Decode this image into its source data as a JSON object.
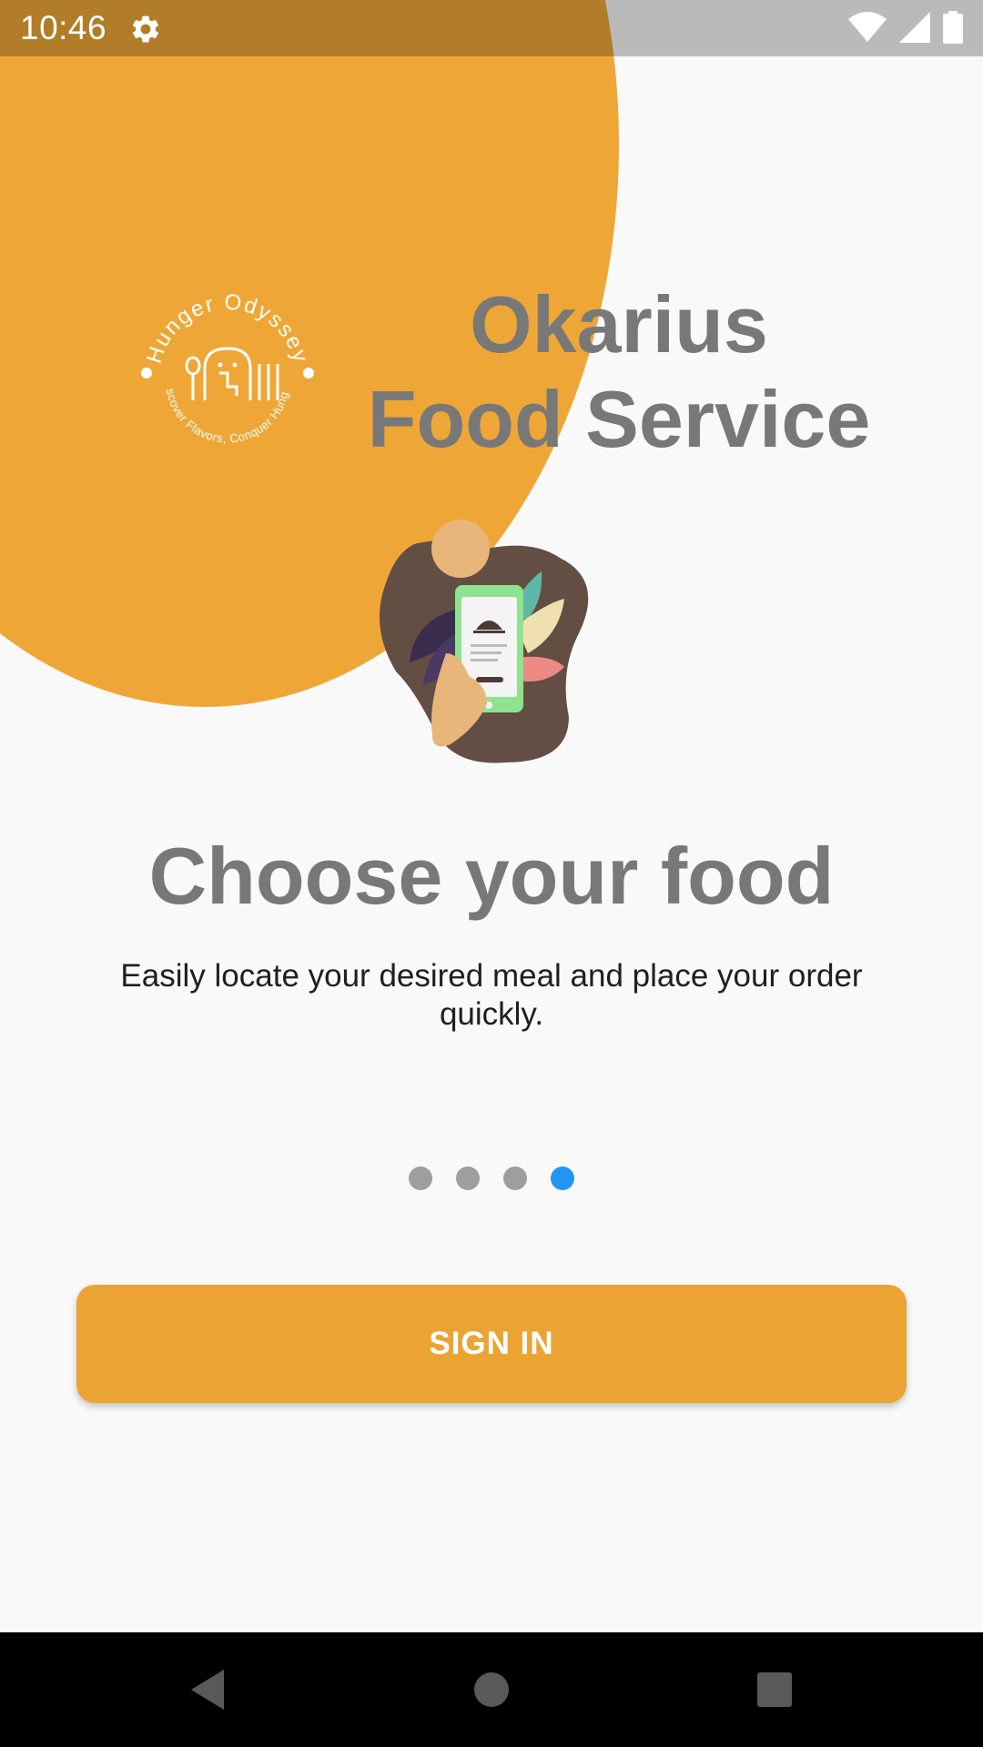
{
  "status_bar": {
    "time": "10:46",
    "icons": [
      "settings-gear-icon",
      "wifi-icon",
      "cell-signal-icon",
      "battery-icon"
    ]
  },
  "logo": {
    "arc_top_text": "Hunger Odyssey",
    "arc_bottom_text": "Discover Flavors, Conquer Hunger!"
  },
  "brand": {
    "line1": "Okarius",
    "line2": "Food Service"
  },
  "onboarding": {
    "headline": "Choose your food",
    "subtitle": "Easily locate your desired meal and place your order quickly.",
    "page_count": 4,
    "active_page": 4
  },
  "actions": {
    "signin_label": "SIGN IN"
  },
  "nav_bar": {
    "icons": [
      "back-icon",
      "home-icon",
      "recents-icon"
    ]
  },
  "colors": {
    "accent_orange": "#eea736",
    "button_orange": "#eba433",
    "title_gray": "#787878",
    "active_dot": "#2196f3",
    "inactive_dot": "#9e9e9e",
    "background": "#f9f9f9"
  }
}
